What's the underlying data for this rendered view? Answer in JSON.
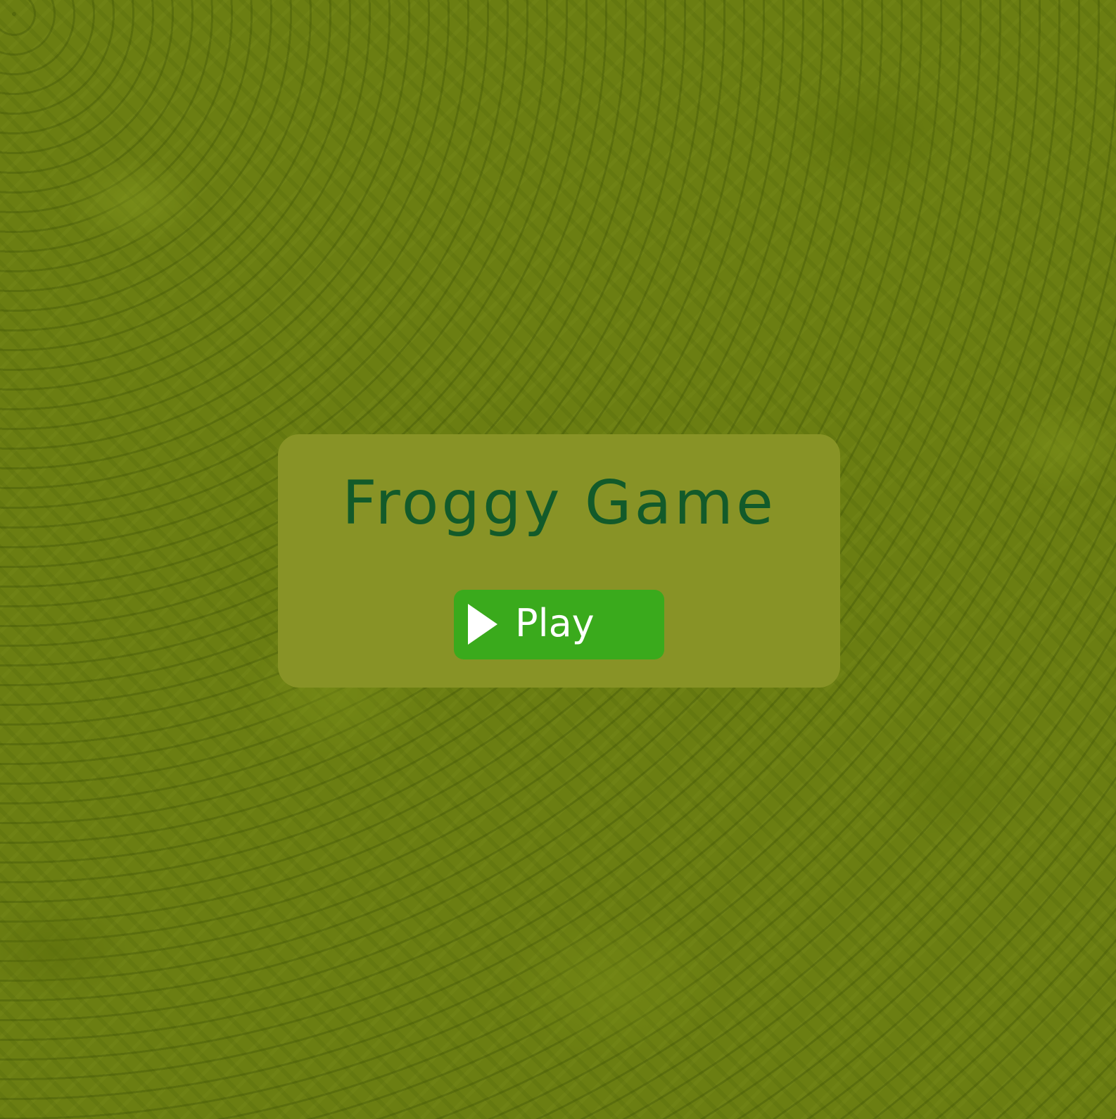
{
  "game": {
    "title": "Froggy Game"
  },
  "menu": {
    "play_label": "Play"
  },
  "icons": {
    "play": "play-triangle-icon"
  },
  "colors": {
    "background": "#6b7e12",
    "panel": "#889326",
    "title": "#125a2a",
    "button": "#3aaa1c",
    "button_text": "#ffffff"
  }
}
